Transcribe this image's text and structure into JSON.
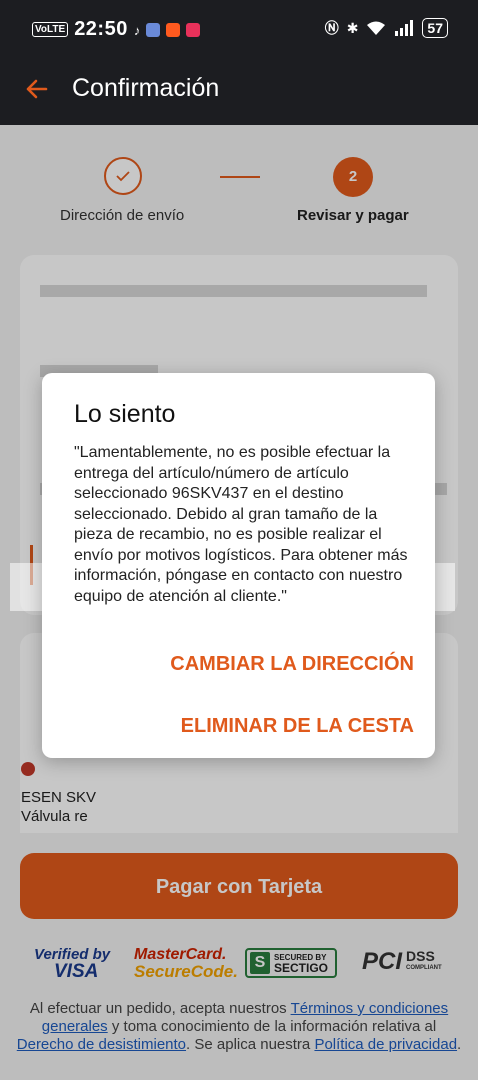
{
  "status_bar": {
    "network": "VoLTE",
    "time": "22:50",
    "battery": "57"
  },
  "header": {
    "title": "Confirmación"
  },
  "steps": [
    {
      "label": "Dirección de envío",
      "state": "done"
    },
    {
      "number": "2",
      "label": "Revisar y pagar",
      "state": "active"
    }
  ],
  "product": {
    "brand_line": "ESEN SKV",
    "name_line": "Válvula re"
  },
  "payment": {
    "button_label": "Pagar con Tarjeta"
  },
  "logos": {
    "visa_line1": "Verified by",
    "visa_line2": "VISA",
    "mc_line1": "MasterCard.",
    "mc_line2": "SecureCode.",
    "sectigo_line1": "SECURED BY",
    "sectigo_line2": "SECTIGO",
    "pci_line1": "PCI",
    "pci_line2": "DSS",
    "pci_line3": "COMPLIANT"
  },
  "legal": {
    "part1": "Al efectuar un pedido, acepta nuestros ",
    "link_terms": "Términos y condiciones generales",
    "part2": " y toma conocimiento de la información relativa al ",
    "link_withdrawal": "Derecho de desistimiento",
    "part3": ". Se aplica nuestra ",
    "link_privacy": "Política de privacidad",
    "part4": "."
  },
  "dialog": {
    "title": "Lo siento",
    "message": "\"Lamentablemente, no es posible efectuar la entrega del artículo/número de artículo seleccionado 96SKV437 en el destino seleccionado. Debido al gran tamaño de la pieza de recambio, no es posible realizar el envío por motivos logísticos. Para obtener más información, póngase en contacto con nuestro equipo de atención al cliente.\"",
    "change_address_label": "CAMBIAR LA DIRECCIÓN",
    "remove_from_cart_label": "ELIMINAR DE LA CESTA"
  },
  "colors": {
    "accent": "#e05a1c",
    "appbar": "#1c1d21"
  }
}
